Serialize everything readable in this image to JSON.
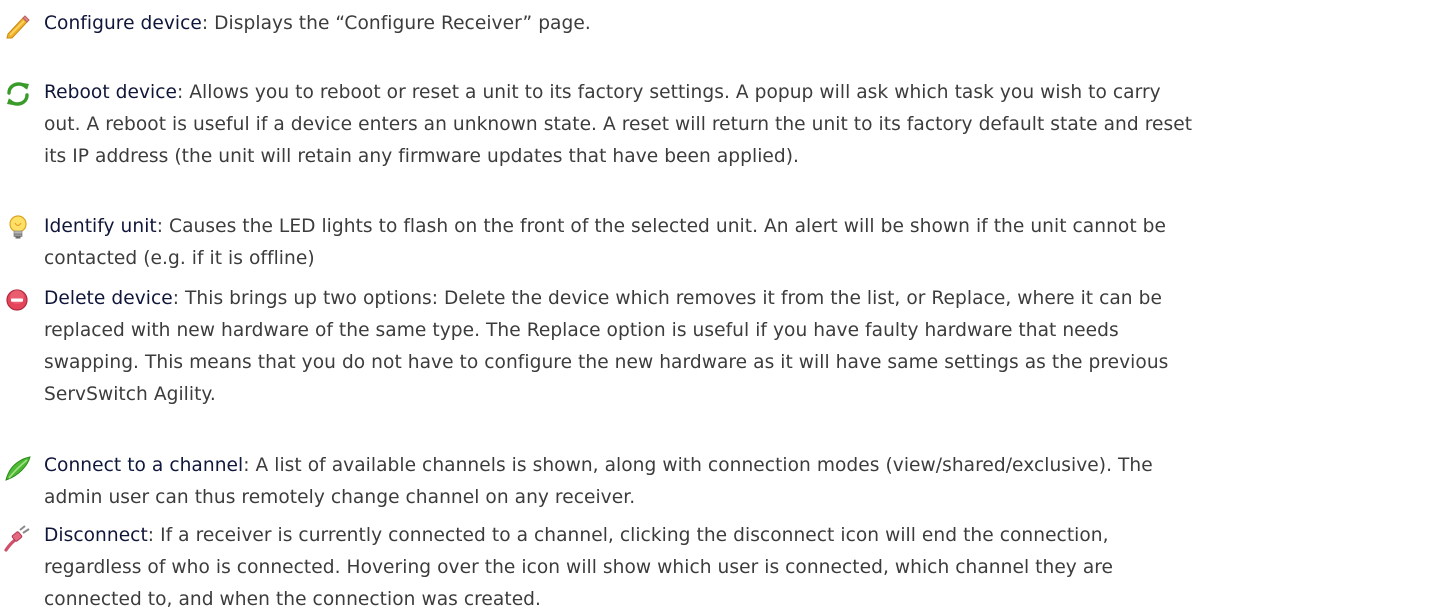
{
  "entries": [
    {
      "icon": "pencil-icon",
      "term": "Configure device",
      "lines": [
        ": Displays the “Configure Receiver” page."
      ]
    },
    {
      "icon": "refresh-arrows-icon",
      "term": "Reboot device",
      "lines": [
        ": Allows you to reboot or reset a unit to its factory settings. A popup will ask which task you wish to carry",
        "out. A reboot is useful if a device enters an unknown state. A reset will return the unit to its factory default state and reset",
        "its IP address (the unit will retain any firmware updates that have been applied)."
      ]
    },
    {
      "icon": "lightbulb-icon",
      "term": "Identify unit",
      "lines": [
        ": Causes the LED lights to flash on the front of the selected unit. An alert will be shown if the unit cannot be",
        "contacted (e.g. if it is offline)"
      ]
    },
    {
      "icon": "delete-circle-icon",
      "term": "Delete device",
      "lines": [
        ": This brings up two options: Delete the device which removes it from the list, or Replace, where it can be",
        "replaced with new hardware of the same type. The Replace option is useful if you have faulty hardware that needs",
        "swapping. This means that you do not have to configure the new hardware as it will have same settings as the previous",
        "ServSwitch Agility."
      ]
    },
    {
      "icon": "connect-plug-icon",
      "term": "Connect to a channel",
      "lines": [
        ": A list of available channels is shown, along with connection modes (view/shared/exclusive). The",
        "admin user can thus remotely change channel on any receiver."
      ]
    },
    {
      "icon": "disconnect-plug-icon",
      "term": "Disconnect",
      "lines": [
        ": If a receiver is currently connected to a channel, clicking the disconnect icon will end the connection,",
        "regardless of who is connected. Hovering over the icon will show which user is connected, which channel they are",
        "connected to, and when the connection was created."
      ]
    }
  ]
}
